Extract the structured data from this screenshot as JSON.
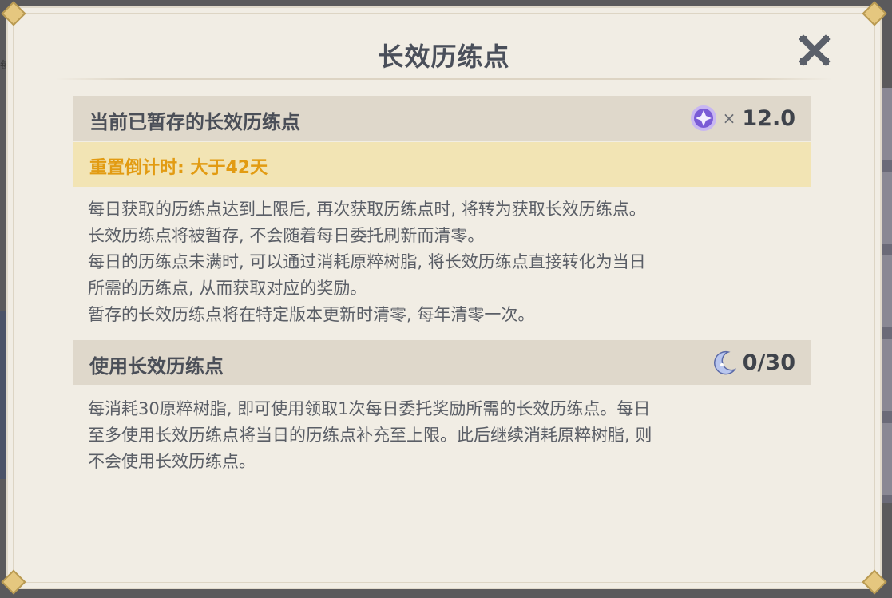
{
  "dialog": {
    "title": "长效历练点"
  },
  "stored_section": {
    "label": "当前已暂存的长效历练点",
    "multiplier": "×",
    "value": "12.0",
    "icon": "purple-star-icon"
  },
  "countdown": {
    "text": "重置倒计时: 大于42天"
  },
  "stored_description": [
    "每日获取的历练点达到上限后, 再次获取历练点时, 将转为获取长效历练点。",
    "长效历练点将被暂存, 不会随着每日委托刷新而清零。",
    "每日的历练点未满时, 可以通过消耗原粹树脂, 将长效历练点直接转化为当日",
    "所需的历练点, 从而获取对应的奖励。",
    "暂存的长效历练点将在特定版本更新时清零, 每年清零一次。"
  ],
  "use_section": {
    "label": "使用长效历练点",
    "value": "0/30",
    "icon": "crescent-moon-icon"
  },
  "use_description": [
    "每消耗30原粹树脂, 即可使用领取1次每日委托奖励所需的长效历练点。每日",
    "至多使用长效历练点将当日的历练点补充至上限。此后继续消耗原粹树脂, 则",
    "不会使用长效历练点。"
  ],
  "background": {
    "left_text": "每"
  },
  "colors": {
    "dialog_bg": "#f1ede4",
    "header_bg": "#dfd8cb",
    "countdown_bg": "#f2e4b4",
    "countdown_text": "#e29b12",
    "title_text": "#4a4f5a"
  }
}
